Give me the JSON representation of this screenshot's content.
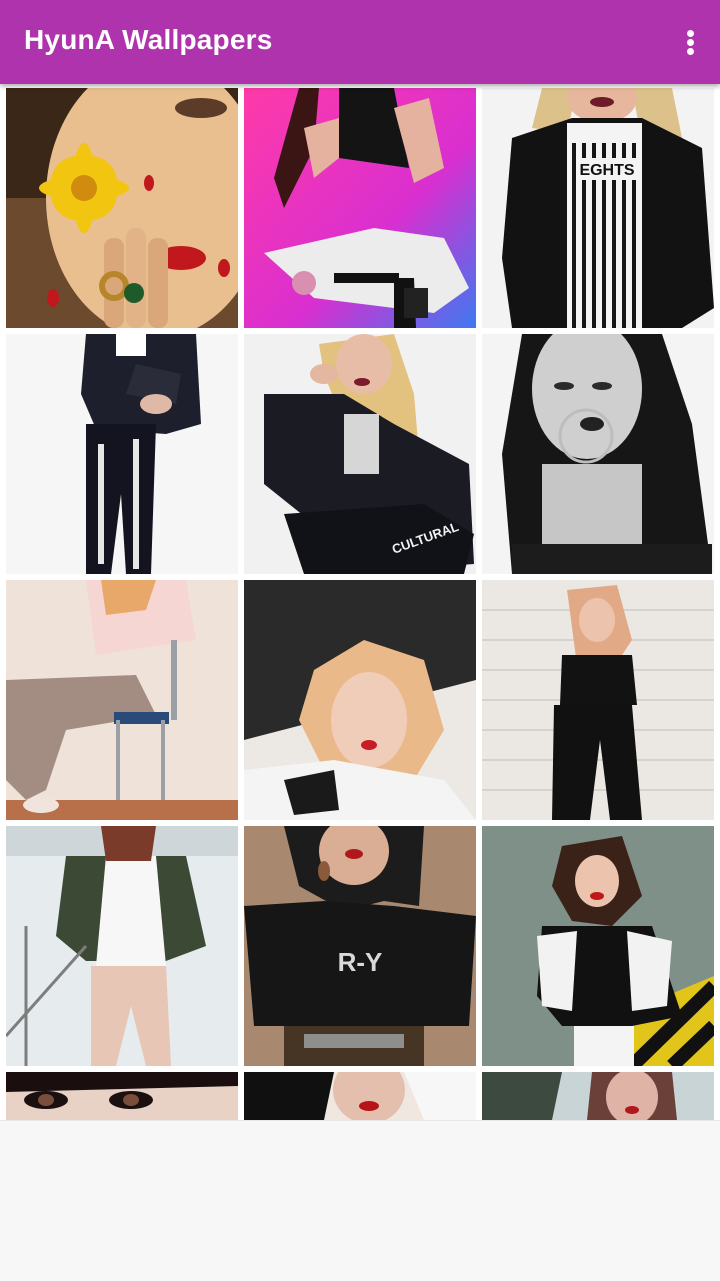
{
  "app_bar": {
    "title": "HyunA Wallpapers",
    "background": "#ae33ad",
    "menu_icon": "more-vert-icon"
  },
  "gallery": {
    "columns": 3,
    "visible_rows": 5,
    "items": [
      {
        "name": "wallpaper-1",
        "palette": [
          "#5a3a20",
          "#e8c27a",
          "#f2c511",
          "#c01818"
        ]
      },
      {
        "name": "wallpaper-2",
        "palette": [
          "#ff2f9e",
          "#3b1010",
          "#e8e8e8",
          "#111111"
        ]
      },
      {
        "name": "wallpaper-3",
        "palette": [
          "#f4f4f4",
          "#111111",
          "#ddc48a",
          "#8a1a30"
        ]
      },
      {
        "name": "wallpaper-4",
        "palette": [
          "#f6f6f6",
          "#1c1c2a",
          "#222233",
          "#e8e8e8"
        ]
      },
      {
        "name": "wallpaper-5",
        "palette": [
          "#f2f2f2",
          "#1e1e26",
          "#e5c985",
          "#111111"
        ]
      },
      {
        "name": "wallpaper-6",
        "palette": [
          "#f1f1f1",
          "#1a1a1a",
          "#c8c8c8",
          "#444444"
        ]
      },
      {
        "name": "wallpaper-7",
        "palette": [
          "#efe3d9",
          "#f6d6d3",
          "#a58f84",
          "#2a4a7a"
        ]
      },
      {
        "name": "wallpaper-8",
        "palette": [
          "#efeae4",
          "#2a2a2a",
          "#e8b88a",
          "#f3f3f3"
        ]
      },
      {
        "name": "wallpaper-9",
        "palette": [
          "#ece9e4",
          "#111111",
          "#e2b89a",
          "#c8c2ba"
        ]
      },
      {
        "name": "wallpaper-10",
        "palette": [
          "#e9eef0",
          "#3c4a35",
          "#f5f5f5",
          "#6a6a6a"
        ]
      },
      {
        "name": "wallpaper-11",
        "palette": [
          "#a58a73",
          "#1c1c1c",
          "#5b4433",
          "#dddddd"
        ]
      },
      {
        "name": "wallpaper-12",
        "palette": [
          "#7d9086",
          "#141414",
          "#f2f2f2",
          "#e2c51a"
        ]
      },
      {
        "name": "wallpaper-13",
        "palette": [
          "#e8d2c6",
          "#1a0e0e",
          "#7a4e3a",
          "#ffffff"
        ]
      },
      {
        "name": "wallpaper-14",
        "palette": [
          "#efe7e0",
          "#101010",
          "#b7141a",
          "#f7f7f7"
        ]
      },
      {
        "name": "wallpaper-15",
        "palette": [
          "#c9d4d6",
          "#6a4038",
          "#e0b3a7",
          "#3c4a40"
        ]
      }
    ]
  }
}
